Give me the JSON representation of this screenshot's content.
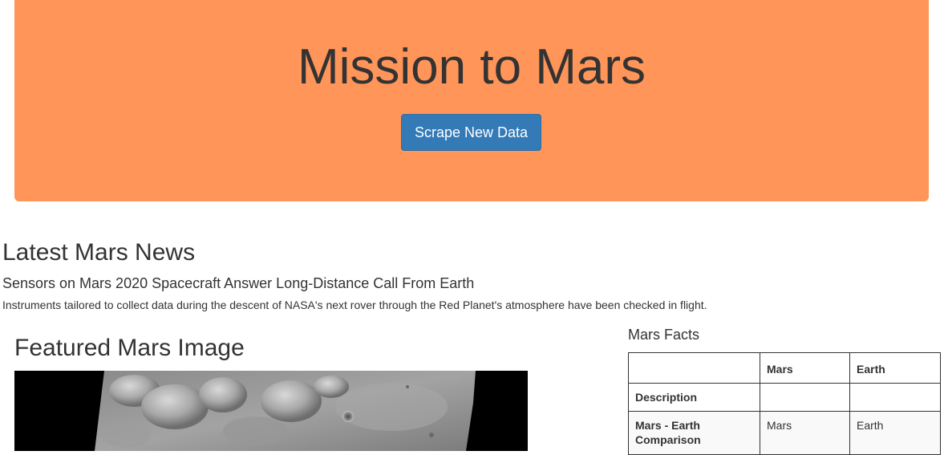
{
  "header": {
    "title": "Mission to Mars",
    "scrape_button_label": "Scrape New Data",
    "background_color": "#ff9559",
    "button_color": "#337ab7"
  },
  "news": {
    "heading": "Latest Mars News",
    "title": "Sensors on Mars 2020 Spacecraft Answer Long-Distance Call From Earth",
    "teaser": "Instruments tailored to collect data during the descent of NASA's next rover through the Red Planet's atmosphere have been checked in flight."
  },
  "featured": {
    "heading": "Featured Mars Image"
  },
  "facts": {
    "heading": "Mars Facts",
    "columns": [
      "",
      "Mars",
      "Earth"
    ],
    "rows": [
      {
        "label": "Description",
        "mars": "",
        "earth": ""
      },
      {
        "label": "Mars - Earth Comparison",
        "mars": "Mars",
        "earth": "Earth"
      }
    ]
  }
}
